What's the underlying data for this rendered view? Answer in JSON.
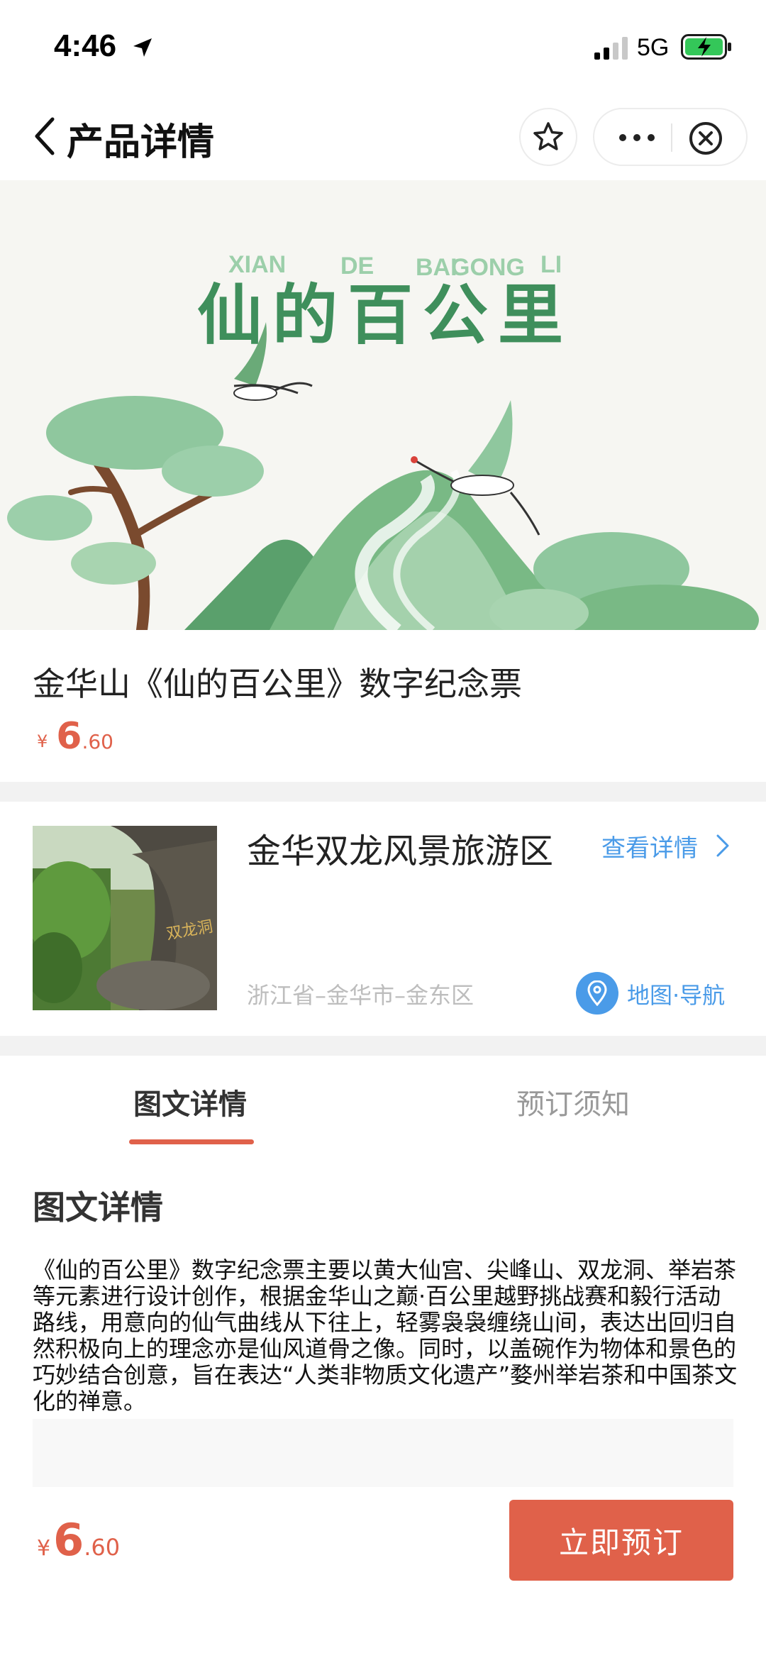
{
  "status_bar": {
    "time": "4:46",
    "network": "5G",
    "icons": [
      "location-arrow-icon",
      "signal-icon",
      "battery-charging-icon"
    ]
  },
  "nav": {
    "title": "产品详情",
    "icons": [
      "chevron-left-icon",
      "star-icon",
      "more-icon",
      "close-icon"
    ]
  },
  "banner": {
    "pinyin": [
      "XIAN",
      "DE",
      "BAI",
      "GONG",
      "LI"
    ],
    "calligraphy": "仙的百公里",
    "colors": {
      "green": "#3f8f5c",
      "light_green": "#8fc79e",
      "background": "#f6f6f2"
    }
  },
  "product": {
    "title": "金华山《仙的百公里》数字纪念票",
    "price": {
      "currency": "¥",
      "integer": "6",
      "decimal": ".60"
    }
  },
  "scenic": {
    "name": "金华双龙风景旅游区",
    "detail_link": "查看详情",
    "address": "浙江省–金华市–金东区",
    "map_label": "地图·导航",
    "image_text": "双龙洞"
  },
  "tabs": [
    {
      "label": "图文详情",
      "active": true
    },
    {
      "label": "预订须知",
      "active": false
    }
  ],
  "content": {
    "section_title": "图文详情",
    "paragraph": "《仙的百公里》数字纪念票主要以黄大仙宫、尖峰山、双龙洞、举岩茶等元素进行设计创作，根据金华山之巅·百公里越野挑战赛和毅行活动路线，用意向的仙气曲线从下往上，轻雾袅袅缠绕山间，表达出回归自然积极向上的理念亦是仙风道骨之像。同时，以盖碗作为物体和景色的巧妙结合创意，旨在表达“人类非物质文化遗产”婺州举岩茶和中国茶文化的禅意。"
  },
  "bottom_bar": {
    "price": {
      "currency": "¥",
      "integer": "6",
      "decimal": ".60"
    },
    "book_button": "立即预订"
  },
  "colors": {
    "accent": "#e0614a",
    "link_blue": "#4a9be8",
    "divider_gray": "#f2f2f2"
  }
}
